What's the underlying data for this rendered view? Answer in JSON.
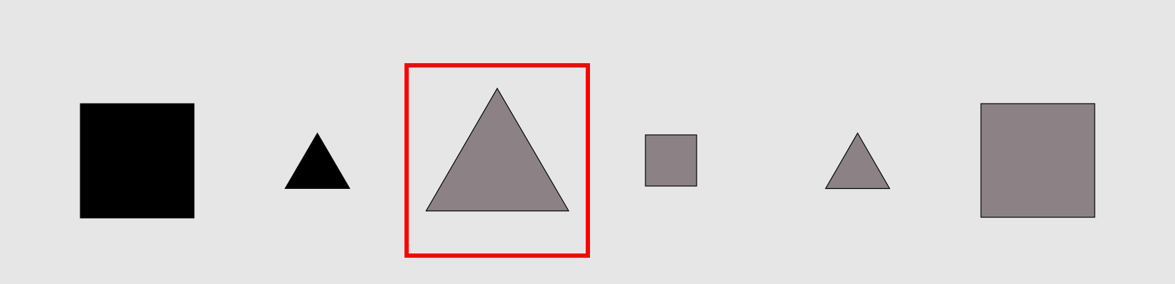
{
  "background_color": "#e6e6e6",
  "selection_color": "#ff0000",
  "shapes": [
    {
      "kind": "square",
      "size": "large",
      "fill": "#000000",
      "selected": false
    },
    {
      "kind": "triangle",
      "size": "small",
      "fill": "#000000",
      "selected": false
    },
    {
      "kind": "triangle",
      "size": "large",
      "fill": "#8c8286",
      "selected": true
    },
    {
      "kind": "square",
      "size": "small",
      "fill": "#8c8286",
      "selected": false
    },
    {
      "kind": "triangle",
      "size": "small",
      "fill": "#8c8286",
      "selected": false
    },
    {
      "kind": "square",
      "size": "large",
      "fill": "#8c8286",
      "selected": false
    }
  ]
}
